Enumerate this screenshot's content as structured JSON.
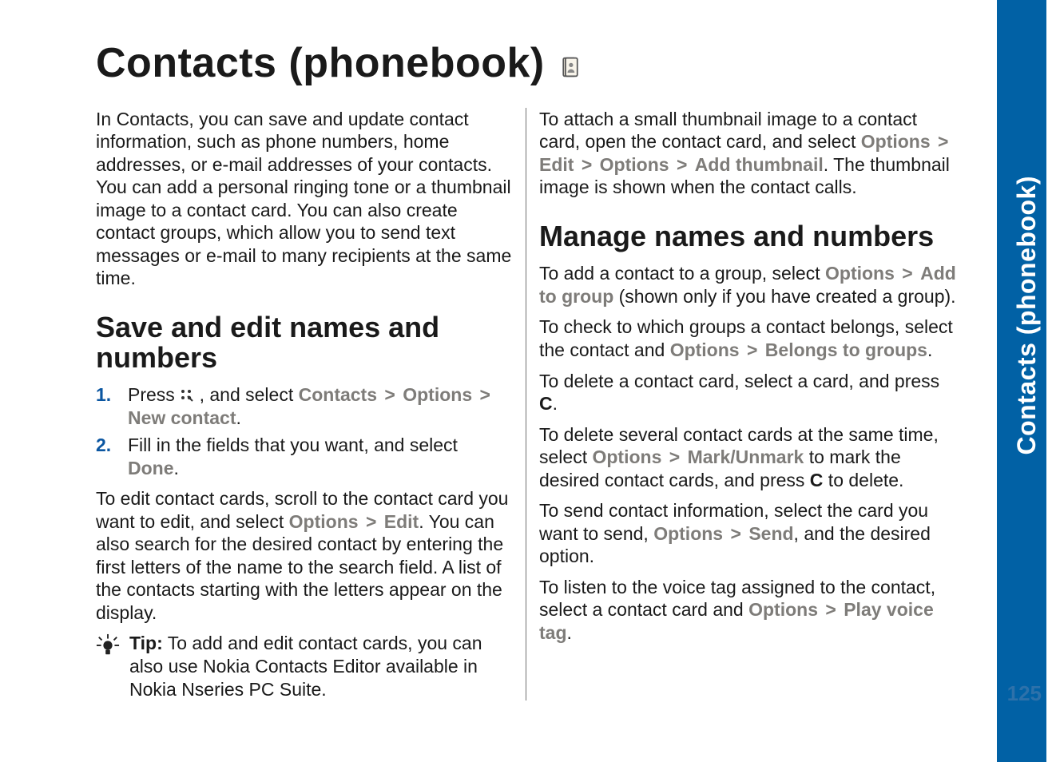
{
  "title": "Contacts (phonebook)",
  "sidebar": {
    "label": "Contacts (phonebook)",
    "page_number": "125"
  },
  "col1": {
    "intro": "In Contacts, you can save and update contact information, such as phone numbers, home addresses, or e-mail addresses of your contacts. You can add a personal ringing tone or a thumbnail image to a contact card. You can also create contact groups, which allow you to send text messages or e-mail to many recipients at the same time.",
    "heading": "Save and edit names and numbers",
    "step1": {
      "num": "1.",
      "pre": "Press ",
      "post": " , and select ",
      "contacts": "Contacts",
      "options": "Options",
      "newcontact": "New contact",
      "dot": "."
    },
    "step2": {
      "num": "2.",
      "pre": "Fill in the fields that you want, and select ",
      "done": "Done",
      "dot": "."
    },
    "edit": {
      "pre": "To edit contact cards, scroll to the contact card you want to edit, and select ",
      "options": "Options",
      "edit": "Edit",
      "post": ". You can also search for the desired contact by entering the first letters of the name to the search field. A list of the contacts starting with the letters appear on the display."
    },
    "tip": {
      "label": "Tip:",
      "body": " To add and edit contact cards, you can also use Nokia Contacts Editor available in Nokia Nseries PC Suite."
    }
  },
  "col2": {
    "thumb": {
      "pre": "To attach a small thumbnail image to a contact card, open the contact card, and select ",
      "options1": "Options",
      "edit": "Edit",
      "options2": "Options",
      "addthumb": "Add thumbnail",
      "post": ". The thumbnail image is shown when the contact calls."
    },
    "heading": "Manage names and numbers",
    "addgroup": {
      "pre": "To add a contact to a group, select ",
      "options": "Options",
      "addto": "Add to group",
      "post": " (shown only if you have created a group)."
    },
    "belongs": {
      "pre": "To check to which groups a contact belongs, select the contact and ",
      "options": "Options",
      "belongs": "Belongs to groups",
      "dot": "."
    },
    "delete": {
      "pre": "To delete a contact card, select a card, and press ",
      "c": "C",
      "dot": "."
    },
    "delmany": {
      "pre": "To delete several contact cards at the same time, select ",
      "options": "Options",
      "mark": "Mark/Unmark",
      "mid": " to mark the desired contact cards, and press ",
      "c": "C",
      "post": " to delete."
    },
    "send": {
      "pre": "To send contact information, select the card you want to send, ",
      "options": "Options",
      "send": "Send",
      "post": ", and the desired option."
    },
    "voice": {
      "pre": "To listen to the voice tag assigned to the contact, select a contact card and ",
      "options": "Options",
      "play": "Play voice tag",
      "dot": "."
    }
  },
  "sep": ">"
}
